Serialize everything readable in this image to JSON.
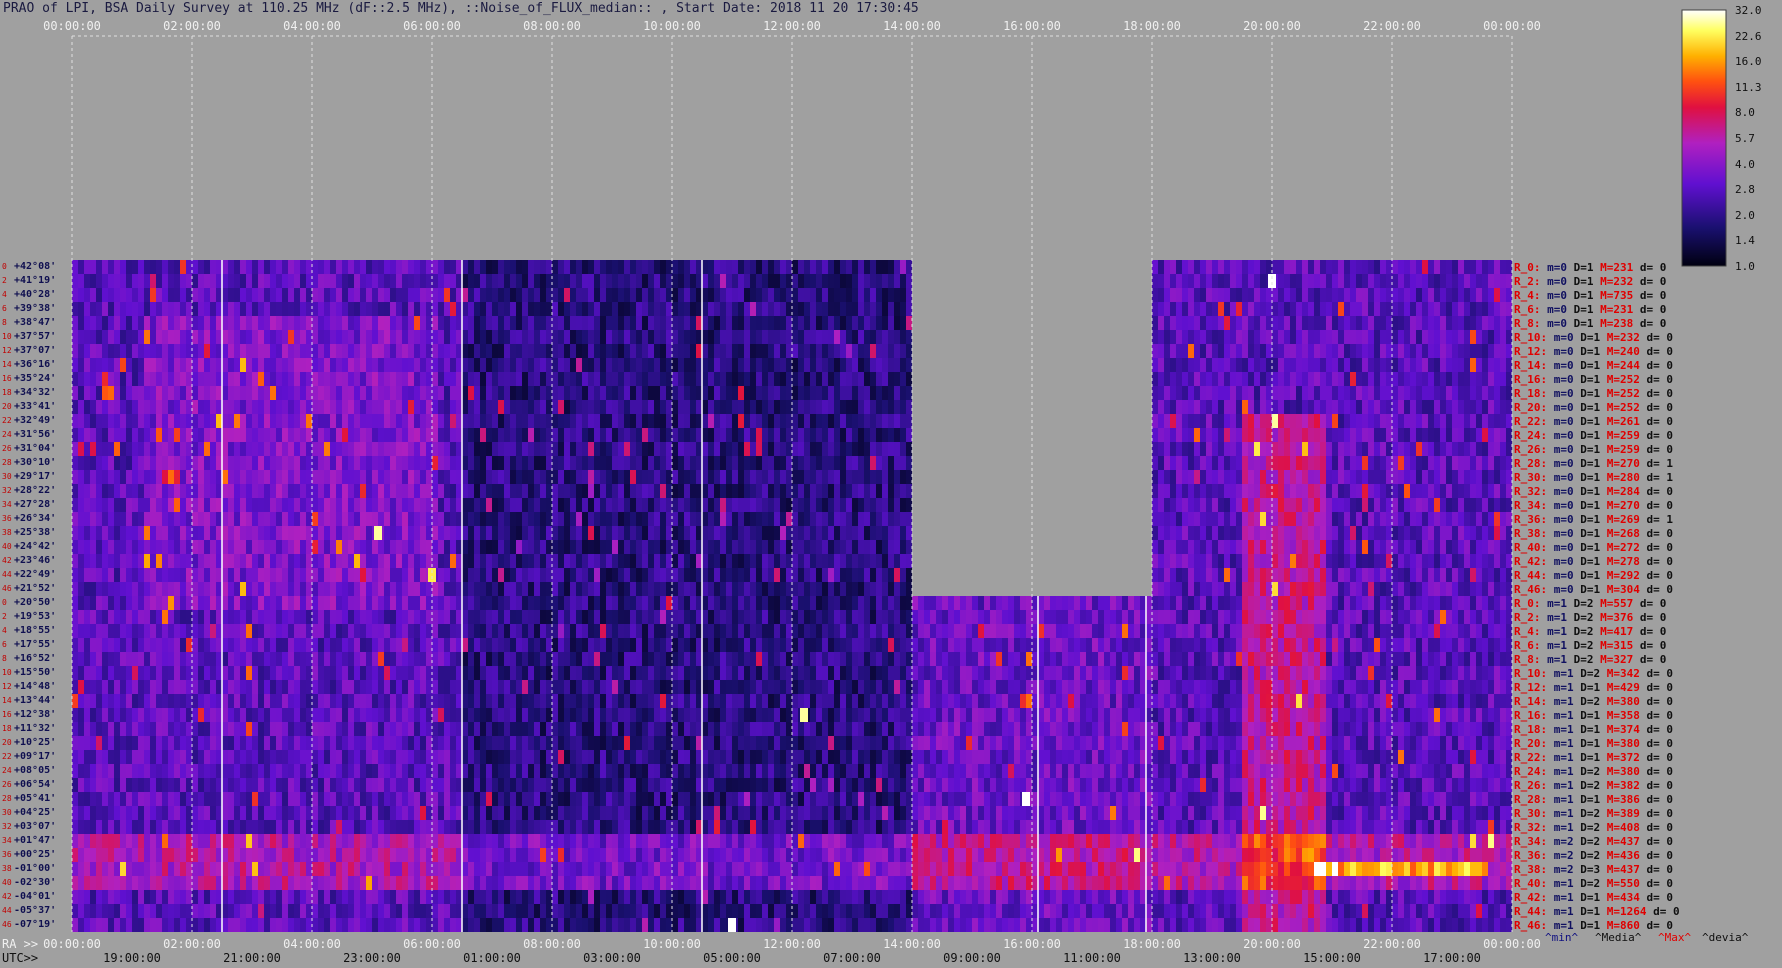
{
  "title": "PRAO of LPI, BSA Daily Survey at 110.25 MHz (dF::2.5 MHz), ::Noise_of_FLUX_median:: , Start Date: 2018 11 20 17:30:45",
  "top_axis_ticks": [
    "00:00:00",
    "02:00:00",
    "04:00:00",
    "06:00:00",
    "08:00:00",
    "10:00:00",
    "12:00:00",
    "14:00:00",
    "16:00:00",
    "18:00:00",
    "20:00:00",
    "22:00:00",
    "00:00:00"
  ],
  "bottom_ra_label": "RA >>",
  "bottom_ra_ticks": [
    "00:00:00",
    "02:00:00",
    "04:00:00",
    "06:00:00",
    "08:00:00",
    "10:00:00",
    "12:00:00",
    "14:00:00",
    "16:00:00",
    "18:00:00",
    "20:00:00",
    "22:00:00",
    "00:00:00"
  ],
  "bottom_utc_label": "UTC>>",
  "bottom_utc_ticks": [
    "19:00:00",
    "21:00:00",
    "23:00:00",
    "01:00:00",
    "03:00:00",
    "05:00:00",
    "07:00:00",
    "09:00:00",
    "11:00:00",
    "13:00:00",
    "15:00:00",
    "17:00:00"
  ],
  "declinations": [
    "+42°08'",
    "+41°19'",
    "+40°28'",
    "+39°38'",
    "+38°47'",
    "+37°57'",
    "+37°07'",
    "+36°16'",
    "+35°24'",
    "+34°32'",
    "+33°41'",
    "+32°49'",
    "+31°56'",
    "+31°04'",
    "+30°10'",
    "+29°17'",
    "+28°22'",
    "+27°28'",
    "+26°34'",
    "+25°38'",
    "+24°42'",
    "+23°46'",
    "+22°49'",
    "+21°52'",
    "+20°50'",
    "+19°53'",
    "+18°55'",
    "+17°55'",
    "+16°52'",
    "+15°50'",
    "+14°48'",
    "+13°44'",
    "+12°38'",
    "+11°32'",
    "+10°25'",
    "+09°17'",
    "+08°05'",
    "+06°54'",
    "+05°41'",
    "+04°25'",
    "+03°07'",
    "+01°47'",
    "+00°25'",
    "-01°00'",
    "-02°30'",
    "-04°01'",
    "-05°37'",
    "-07°19'"
  ],
  "row_indices": [
    "0",
    "2",
    "4",
    "6",
    "8",
    "10",
    "12",
    "14",
    "16",
    "18",
    "20",
    "22",
    "24",
    "26",
    "28",
    "30",
    "32",
    "34",
    "36",
    "38",
    "40",
    "42",
    "44",
    "46",
    "0",
    "2",
    "4",
    "6",
    "8",
    "10",
    "12",
    "14",
    "16",
    "18",
    "20",
    "22",
    "24",
    "26",
    "28",
    "30",
    "32",
    "34",
    "36",
    "38",
    "40",
    "42",
    "44",
    "46"
  ],
  "stats": [
    {
      "r": "R_0:",
      "m": "m=0",
      "D": "D=1",
      "M": "M=231",
      "d": "d= 0"
    },
    {
      "r": "R_2:",
      "m": "m=0",
      "D": "D=1",
      "M": "M=232",
      "d": "d= 0"
    },
    {
      "r": "R_4:",
      "m": "m=0",
      "D": "D=1",
      "M": "M=735",
      "d": "d= 0"
    },
    {
      "r": "R_6:",
      "m": "m=0",
      "D": "D=1",
      "M": "M=231",
      "d": "d= 0"
    },
    {
      "r": "R_8:",
      "m": "m=0",
      "D": "D=1",
      "M": "M=238",
      "d": "d= 0"
    },
    {
      "r": "R_10:",
      "m": "m=0",
      "D": "D=1",
      "M": "M=232",
      "d": "d= 0"
    },
    {
      "r": "R_12:",
      "m": "m=0",
      "D": "D=1",
      "M": "M=240",
      "d": "d= 0"
    },
    {
      "r": "R_14:",
      "m": "m=0",
      "D": "D=1",
      "M": "M=244",
      "d": "d= 0"
    },
    {
      "r": "R_16:",
      "m": "m=0",
      "D": "D=1",
      "M": "M=252",
      "d": "d= 0"
    },
    {
      "r": "R_18:",
      "m": "m=0",
      "D": "D=1",
      "M": "M=252",
      "d": "d= 0"
    },
    {
      "r": "R_20:",
      "m": "m=0",
      "D": "D=1",
      "M": "M=252",
      "d": "d= 0"
    },
    {
      "r": "R_22:",
      "m": "m=0",
      "D": "D=1",
      "M": "M=261",
      "d": "d= 0"
    },
    {
      "r": "R_24:",
      "m": "m=0",
      "D": "D=1",
      "M": "M=259",
      "d": "d= 0"
    },
    {
      "r": "R_26:",
      "m": "m=0",
      "D": "D=1",
      "M": "M=259",
      "d": "d= 0"
    },
    {
      "r": "R_28:",
      "m": "m=0",
      "D": "D=1",
      "M": "M=270",
      "d": "d= 1"
    },
    {
      "r": "R_30:",
      "m": "m=0",
      "D": "D=1",
      "M": "M=280",
      "d": "d= 1"
    },
    {
      "r": "R_32:",
      "m": "m=0",
      "D": "D=1",
      "M": "M=284",
      "d": "d= 0"
    },
    {
      "r": "R_34:",
      "m": "m=0",
      "D": "D=1",
      "M": "M=270",
      "d": "d= 0"
    },
    {
      "r": "R_36:",
      "m": "m=0",
      "D": "D=1",
      "M": "M=269",
      "d": "d= 1"
    },
    {
      "r": "R_38:",
      "m": "m=0",
      "D": "D=1",
      "M": "M=268",
      "d": "d= 0"
    },
    {
      "r": "R_40:",
      "m": "m=0",
      "D": "D=1",
      "M": "M=272",
      "d": "d= 0"
    },
    {
      "r": "R_42:",
      "m": "m=0",
      "D": "D=1",
      "M": "M=278",
      "d": "d= 0"
    },
    {
      "r": "R_44:",
      "m": "m=0",
      "D": "D=1",
      "M": "M=292",
      "d": "d= 0"
    },
    {
      "r": "R_46:",
      "m": "m=0",
      "D": "D=1",
      "M": "M=304",
      "d": "d= 0"
    },
    {
      "r": "R_0:",
      "m": "m=1",
      "D": "D=2",
      "M": "M=557",
      "d": "d= 0"
    },
    {
      "r": "R_2:",
      "m": "m=1",
      "D": "D=2",
      "M": "M=376",
      "d": "d= 0"
    },
    {
      "r": "R_4:",
      "m": "m=1",
      "D": "D=2",
      "M": "M=417",
      "d": "d= 0"
    },
    {
      "r": "R_6:",
      "m": "m=1",
      "D": "D=2",
      "M": "M=315",
      "d": "d= 0"
    },
    {
      "r": "R_8:",
      "m": "m=1",
      "D": "D=2",
      "M": "M=327",
      "d": "d= 0"
    },
    {
      "r": "R_10:",
      "m": "m=1",
      "D": "D=2",
      "M": "M=342",
      "d": "d= 0"
    },
    {
      "r": "R_12:",
      "m": "m=1",
      "D": "D=1",
      "M": "M=429",
      "d": "d= 0"
    },
    {
      "r": "R_14:",
      "m": "m=1",
      "D": "D=2",
      "M": "M=380",
      "d": "d= 0"
    },
    {
      "r": "R_16:",
      "m": "m=1",
      "D": "D=1",
      "M": "M=358",
      "d": "d= 0"
    },
    {
      "r": "R_18:",
      "m": "m=1",
      "D": "D=1",
      "M": "M=374",
      "d": "d= 0"
    },
    {
      "r": "R_20:",
      "m": "m=1",
      "D": "D=1",
      "M": "M=380",
      "d": "d= 0"
    },
    {
      "r": "R_22:",
      "m": "m=1",
      "D": "D=1",
      "M": "M=372",
      "d": "d= 0"
    },
    {
      "r": "R_24:",
      "m": "m=1",
      "D": "D=2",
      "M": "M=380",
      "d": "d= 0"
    },
    {
      "r": "R_26:",
      "m": "m=1",
      "D": "D=2",
      "M": "M=382",
      "d": "d= 0"
    },
    {
      "r": "R_28:",
      "m": "m=1",
      "D": "D=1",
      "M": "M=386",
      "d": "d= 0"
    },
    {
      "r": "R_30:",
      "m": "m=1",
      "D": "D=2",
      "M": "M=389",
      "d": "d= 0"
    },
    {
      "r": "R_32:",
      "m": "m=1",
      "D": "D=2",
      "M": "M=408",
      "d": "d= 0"
    },
    {
      "r": "R_34:",
      "m": "m=2",
      "D": "D=2",
      "M": "M=437",
      "d": "d= 0"
    },
    {
      "r": "R_36:",
      "m": "m=2",
      "D": "D=2",
      "M": "M=436",
      "d": "d= 0"
    },
    {
      "r": "R_38:",
      "m": "m=2",
      "D": "D=3",
      "M": "M=437",
      "d": "d= 0"
    },
    {
      "r": "R_40:",
      "m": "m=1",
      "D": "D=2",
      "M": "M=550",
      "d": "d= 0"
    },
    {
      "r": "R_42:",
      "m": "m=1",
      "D": "D=1",
      "M": "M=434",
      "d": "d= 0"
    },
    {
      "r": "R_44:",
      "m": "m=1",
      "D": "D=1",
      "M": "M=1264",
      "d": "d= 0"
    },
    {
      "r": "R_46:",
      "m": "m=1",
      "D": "D=1",
      "M": "M=860",
      "d": "d= 0"
    }
  ],
  "stats_legend": {
    "min": "^min^",
    "media": "^Media^",
    "max": "^Max^",
    "devia": "^devia^"
  },
  "colors": {
    "background": "#a0a0a0",
    "min_color": "#101080",
    "media_color": "#101010",
    "max_color": "#e00000",
    "devia_color": "#101010"
  },
  "chart_data": {
    "type": "heatmap",
    "title": "PRAO of LPI, BSA Daily Survey at 110.25 MHz (dF::2.5 MHz), ::Noise_of_FLUX_median:: , Start Date: 2018 11 20 17:30:45",
    "x_axis": "RA 00:00:00 – 24:00:00 (UTC 17:30 – 17:30)",
    "y_axis": "Declination +42°08' … -07°19', 48 beams",
    "colorbar": {
      "ticks": [
        "32.0",
        "22.6",
        "16.0",
        "11.3",
        "8.0",
        "5.7",
        "4.0",
        "2.8",
        "2.0",
        "1.4",
        "1.0"
      ],
      "range": [
        1.0,
        32.0
      ],
      "scale": "log",
      "colormap": "black-blue-purple-red-yellow-white"
    },
    "missing_data": [
      {
        "ra_start_h": 14.0,
        "ra_end_h": 18.0,
        "decl_from": "+42°08'",
        "decl_to": "+21°52'"
      }
    ],
    "features": [
      {
        "label": "noise band",
        "decl": "+00°25' … -02°30'",
        "ra_h": [
          0,
          24
        ]
      },
      {
        "label": "strong emission",
        "ra_h": [
          19.5,
          20.8
        ],
        "decl": "+42°08' … -07°19'"
      },
      {
        "label": "bright stripe",
        "ra_h": [
          20.5,
          23.5
        ],
        "decl": "-01°00'"
      }
    ]
  }
}
